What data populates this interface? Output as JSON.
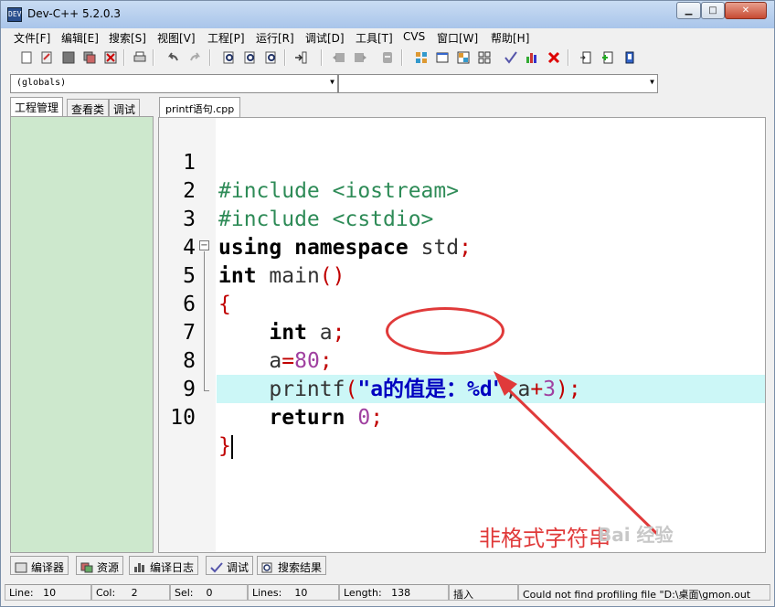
{
  "window": {
    "title": "Dev-C++ 5.2.0.3",
    "app_icon_text": "DEV"
  },
  "menu": [
    "文件[F]",
    "编辑[E]",
    "搜索[S]",
    "视图[V]",
    "工程[P]",
    "运行[R]",
    "调试[D]",
    "工具[T]",
    "CVS",
    "窗口[W]",
    "帮助[H]"
  ],
  "combos": {
    "scope": "(globals)",
    "function": ""
  },
  "left_tabs": [
    "工程管理",
    "查看类",
    "调试"
  ],
  "editor_tab": "printf语句.cpp",
  "code": {
    "line_numbers": [
      "1",
      "2",
      "3",
      "4",
      "5",
      "6",
      "7",
      "8",
      "9",
      "10"
    ],
    "l1": {
      "a": "#include <iostream>"
    },
    "l2": {
      "a": "#include <cstdio>"
    },
    "l3": {
      "kw1": "using",
      "kw2": "namespace",
      "id": "std",
      "semi": ";"
    },
    "l4": {
      "kw": "int",
      "id": "main",
      "paren": "()"
    },
    "l5": {
      "brace": "{"
    },
    "l6": {
      "kw": "int",
      "id": "a",
      "semi": ";"
    },
    "l7": {
      "id": "a",
      "eq": "=",
      "num": "80",
      "semi": ";"
    },
    "l8": {
      "fn": "printf",
      "lp": "(",
      "str": "\"a的值是：%d\"",
      "comma": ",",
      "id": "a",
      "plus": "+",
      "num": "3",
      "rp": ")",
      "semi": ";"
    },
    "l9": {
      "kw": "return",
      "num": "0",
      "semi": ";"
    },
    "l10": {
      "brace": "}"
    },
    "current_line": 10
  },
  "annotation": "非格式字符串",
  "watermark": "Bai 经验",
  "bottom_tabs": [
    "编译器",
    "资源",
    "编译日志",
    "调试",
    "搜索结果"
  ],
  "status": {
    "line_label": "Line:",
    "line_value": "10",
    "col_label": "Col:",
    "col_value": "2",
    "sel_label": "Sel:",
    "sel_value": "0",
    "lines_label": "Lines:",
    "lines_value": "10",
    "length_label": "Length:",
    "length_value": "138",
    "mode": "插入",
    "message": "Could not find profiling file \"D:\\桌面\\gmon.out"
  },
  "colors": {
    "accent_red": "#e03a3a",
    "left_panel": "#cde8cd",
    "current_line": "#ccf7f7"
  }
}
